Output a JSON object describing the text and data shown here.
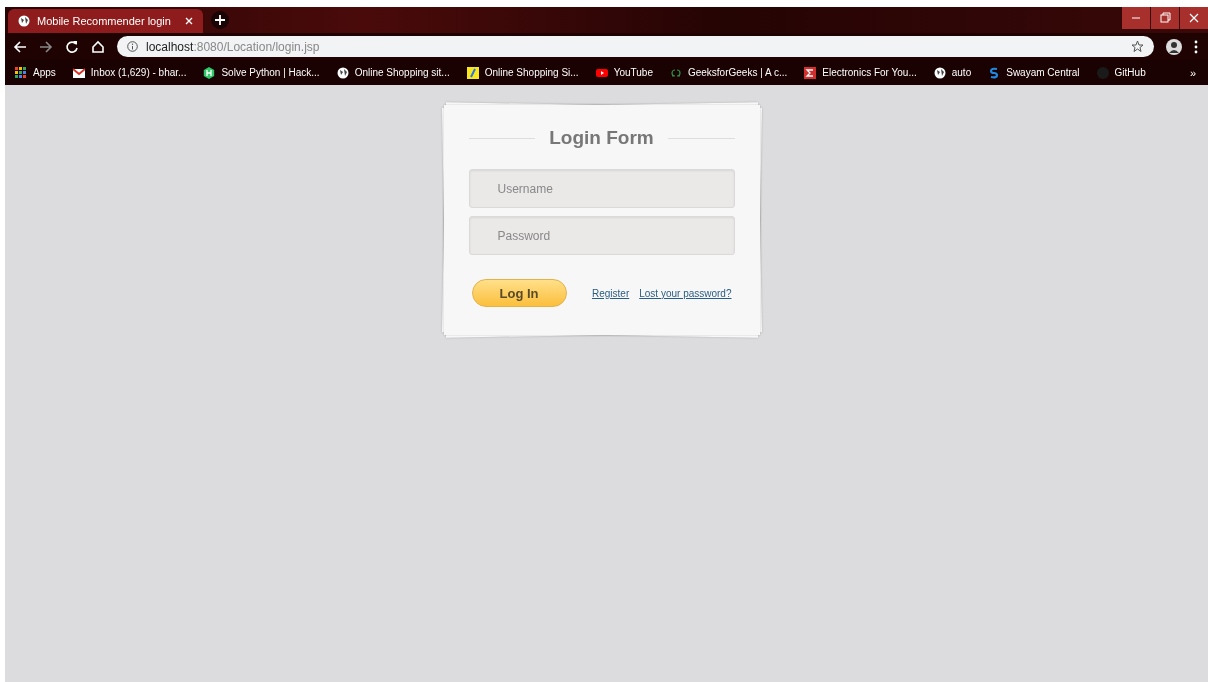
{
  "window": {
    "tab_title": "Mobile Recommender login",
    "url_host": "localhost",
    "url_path": ":8080/Location/login.jsp"
  },
  "bookmarks": [
    {
      "kind": "apps",
      "label": "Apps"
    },
    {
      "kind": "mail",
      "label": "Inbox (1,629) - bhar..."
    },
    {
      "kind": "hexagon",
      "label": "Solve Python | Hack..."
    },
    {
      "kind": "globe",
      "label": "Online Shopping sit..."
    },
    {
      "kind": "cart",
      "label": "Online Shopping Si..."
    },
    {
      "kind": "play",
      "label": "YouTube"
    },
    {
      "kind": "gg",
      "label": "GeeksforGeeks | A c..."
    },
    {
      "kind": "sigma",
      "label": "Electronics For You..."
    },
    {
      "kind": "globe",
      "label": "auto"
    },
    {
      "kind": "s",
      "label": "Swayam Central"
    },
    {
      "kind": "octocat",
      "label": "GitHub"
    }
  ],
  "more_bookmarks": "»",
  "login": {
    "title": "Login Form",
    "fields": [
      {
        "placeholder": "Username"
      },
      {
        "placeholder": "Password"
      }
    ],
    "button": "Log In",
    "links": [
      "Register",
      "Lost your password?"
    ]
  }
}
